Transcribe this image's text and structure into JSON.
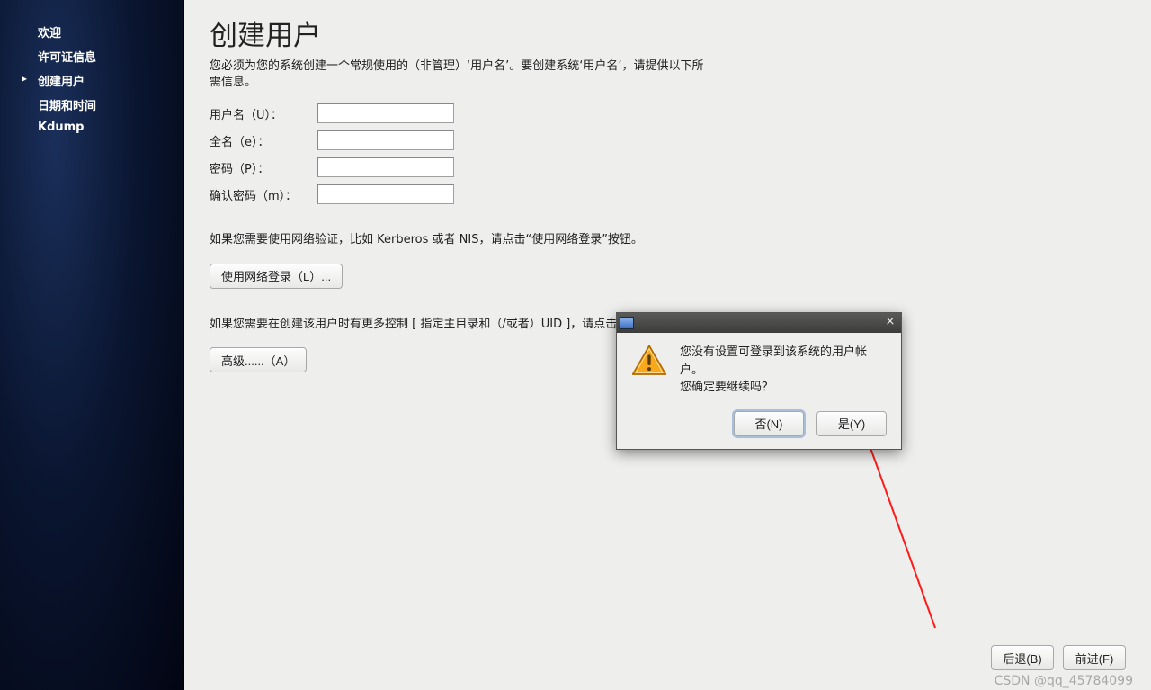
{
  "sidebar": {
    "items": [
      {
        "label": "欢迎",
        "active": false
      },
      {
        "label": "许可证信息",
        "active": false
      },
      {
        "label": "创建用户",
        "active": true
      },
      {
        "label": "日期和时间",
        "active": false
      },
      {
        "label": "Kdump",
        "active": false
      }
    ]
  },
  "page": {
    "title": "创建用户",
    "intro": "您必须为您的系统创建一个常规使用的（非管理）‘用户名’。要创建系统‘用户名’，请提供以下所需信息。"
  },
  "form": {
    "username_label": "用户名（U）：",
    "fullname_label": "全名（e）：",
    "password_label": "密码（P）：",
    "confirm_label": "确认密码（m）：",
    "username_value": "",
    "fullname_value": "",
    "password_value": "",
    "confirm_value": ""
  },
  "texts": {
    "network_login_hint": "如果您需要使用网络验证，比如 Kerberos 或者 NIS，请点击“使用网络登录”按钮。",
    "advanced_hint": "如果您需要在创建该用户时有更多控制 [ 指定主目录和（/或者）UID ]，请点击高级按钮。"
  },
  "buttons": {
    "network_login": "使用网络登录（L）...",
    "advanced": "高级......（A）",
    "back": "后退(B)",
    "forward": "前进(F)"
  },
  "dialog": {
    "line1": "您没有设置可登录到该系统的用户帐户。",
    "line2": "您确定要继续吗？",
    "no": "否(N)",
    "yes": "是(Y)"
  },
  "watermark": "CSDN @qq_45784099"
}
